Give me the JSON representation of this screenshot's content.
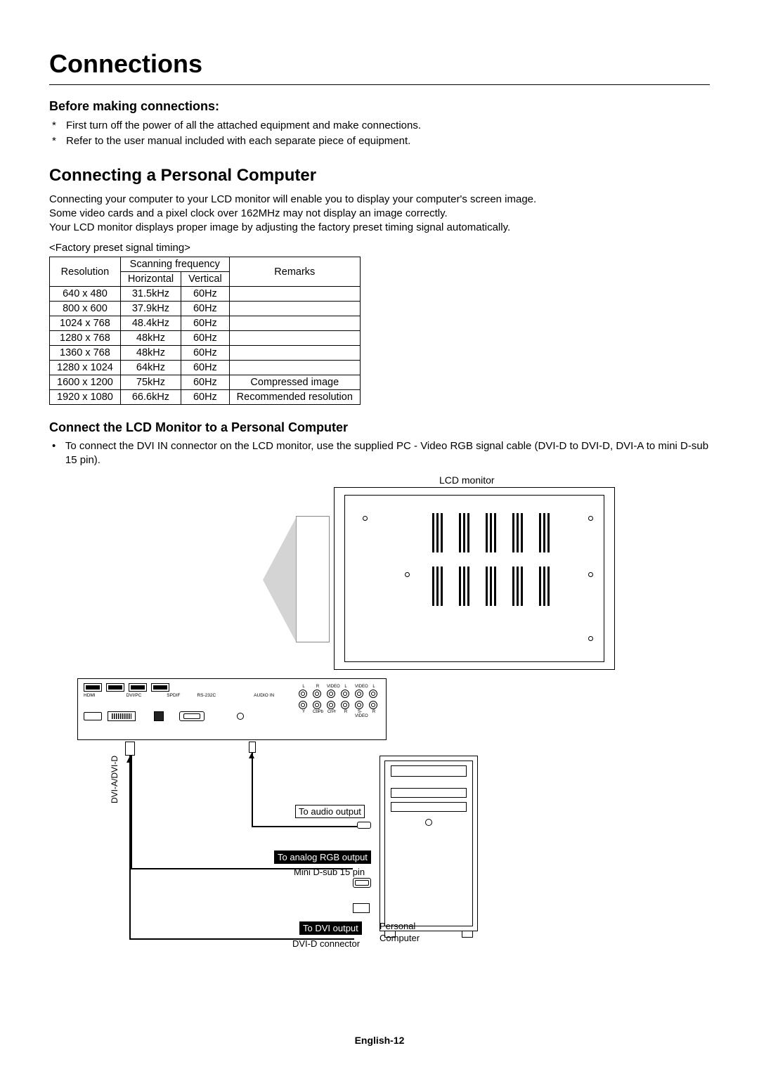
{
  "title": "Connections",
  "before": {
    "heading": "Before making connections:",
    "items": [
      "First turn off the power of all the attached equipment and make connections.",
      "Refer to the user manual included with each separate piece of equipment."
    ]
  },
  "pc_section": {
    "heading": "Connecting a Personal Computer",
    "para1": "Connecting your computer to your LCD monitor will enable you to display your computer's screen image.",
    "para2": "Some video cards and a pixel clock over 162MHz may not display an image correctly.",
    "para3": "Your LCD monitor displays proper image by adjusting the factory preset timing signal automatically."
  },
  "table": {
    "caption": "<Factory preset signal timing>",
    "headers": {
      "resolution": "Resolution",
      "scan": "Scanning frequency",
      "horizontal": "Horizontal",
      "vertical": "Vertical",
      "remarks": "Remarks"
    },
    "rows": [
      {
        "res": "640 x 480",
        "h": "31.5kHz",
        "v": "60Hz",
        "r": ""
      },
      {
        "res": "800 x 600",
        "h": "37.9kHz",
        "v": "60Hz",
        "r": ""
      },
      {
        "res": "1024 x 768",
        "h": "48.4kHz",
        "v": "60Hz",
        "r": ""
      },
      {
        "res": "1280 x 768",
        "h": "48kHz",
        "v": "60Hz",
        "r": ""
      },
      {
        "res": "1360 x 768",
        "h": "48kHz",
        "v": "60Hz",
        "r": ""
      },
      {
        "res": "1280 x 1024",
        "h": "64kHz",
        "v": "60Hz",
        "r": ""
      },
      {
        "res": "1600 x 1200",
        "h": "75kHz",
        "v": "60Hz",
        "r": "Compressed image"
      },
      {
        "res": "1920 x 1080",
        "h": "66.6kHz",
        "v": "60Hz",
        "r": "Recommended resolution"
      }
    ]
  },
  "connect": {
    "heading": "Connect the LCD Monitor to a Personal Computer",
    "bullet": "To connect the DVI IN connector on the LCD monitor, use the supplied PC - Video RGB signal cable (DVI-D to DVI-D, DVI-A to mini D-sub 15 pin)."
  },
  "diagram": {
    "lcd_label": "LCD monitor",
    "dvi_cable": "DVI-A/DVI-D",
    "audio_tag": "To audio output",
    "rgb_tag": "To analog RGB output",
    "dsub_label": "Mini D-sub 15 pin",
    "dvi_tag": "To DVI output",
    "dvid_label": "DVI-D connector",
    "pc_label1": "Personal",
    "pc_label2": "Computer",
    "io": {
      "hdmi": "HDMI",
      "dvipc": "DVI/PC",
      "spdif": "SPDIF",
      "rs232": "RS-232C",
      "audio_in": "AUDIO IN",
      "top_l": "L",
      "top_r": "R",
      "top_video1": "VIDEO",
      "top_l2": "L",
      "top_video2": "VIDEO",
      "top_l3": "L",
      "bot_y": "Y",
      "bot_cbpb": "CbPb",
      "bot_crpr": "CrPr",
      "bot_r": "R",
      "bot_svideo": "S-VIDEO",
      "bot_r2": "R"
    }
  },
  "footer": "English-12"
}
